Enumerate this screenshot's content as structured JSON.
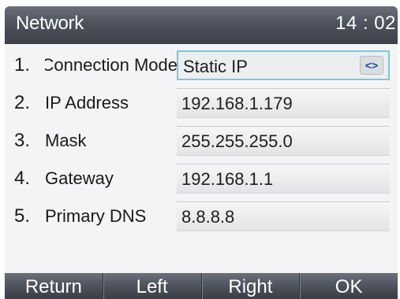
{
  "header": {
    "title": "Network",
    "time": "14 : 02"
  },
  "rows": [
    {
      "number": "1.",
      "label": "Connection Mode",
      "value": "Static IP",
      "type": "select",
      "spin_icon": "left-right-arrows-icon",
      "spin_glyph": "<>"
    },
    {
      "number": "2.",
      "label": "IP Address",
      "value": "192.168.1.179",
      "type": "input"
    },
    {
      "number": "3.",
      "label": "Mask",
      "value": "255.255.255.0",
      "type": "input"
    },
    {
      "number": "4.",
      "label": "Gateway",
      "value": "192.168.1.1",
      "type": "input"
    },
    {
      "number": "5.",
      "label": "Primary  DNS",
      "value": "8.8.8.8",
      "type": "input"
    }
  ],
  "softkeys": [
    "Return",
    "Left",
    "Right",
    "OK"
  ],
  "colors": {
    "titlebar": "#4f535d",
    "select_border": "#7fc6d8",
    "background": "#f4f4f6"
  }
}
